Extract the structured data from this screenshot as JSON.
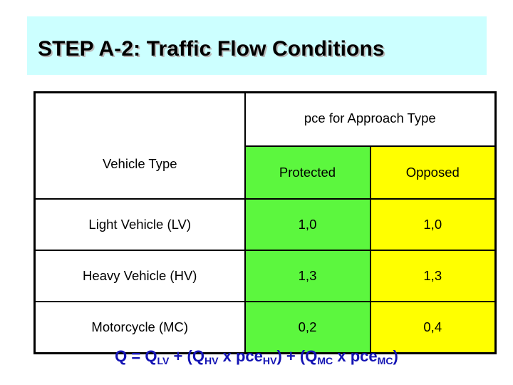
{
  "slide": {
    "title": "STEP A-2: Traffic Flow Conditions",
    "title_band_color": "#ccffff",
    "title_color": "#000000"
  },
  "table": {
    "row_header_label": "Vehicle Type",
    "group_header_label": "pce for Approach Type",
    "columns": [
      {
        "label": "Protected",
        "color": "#5cf73e"
      },
      {
        "label": "Opposed",
        "color": "#ffff00"
      }
    ],
    "rows": [
      {
        "vehicle_type": "Light Vehicle (LV)",
        "protected": "1,0",
        "opposed": "1,0"
      },
      {
        "vehicle_type": "Heavy Vehicle (HV)",
        "protected": "1,3",
        "opposed": "1,3"
      },
      {
        "vehicle_type": "Motorcycle (MC)",
        "protected": "0,2",
        "opposed": "0,4"
      }
    ]
  },
  "formula": {
    "color": "#1414b4",
    "plain": "Q = QLV + (QHV x pceHV) + (QMC x pceMC)",
    "parts": {
      "q": "Q",
      "equals": " = ",
      "q1": "Q",
      "sub1": "LV",
      "plus1": " + (",
      "q2": "Q",
      "sub2": "HV",
      "times1": " x pce",
      "sub3": "HV",
      "close1": ") + (",
      "q3": "Q",
      "sub4": "MC",
      "times2": " x pce",
      "sub5": "MC",
      "close2": ")"
    }
  }
}
